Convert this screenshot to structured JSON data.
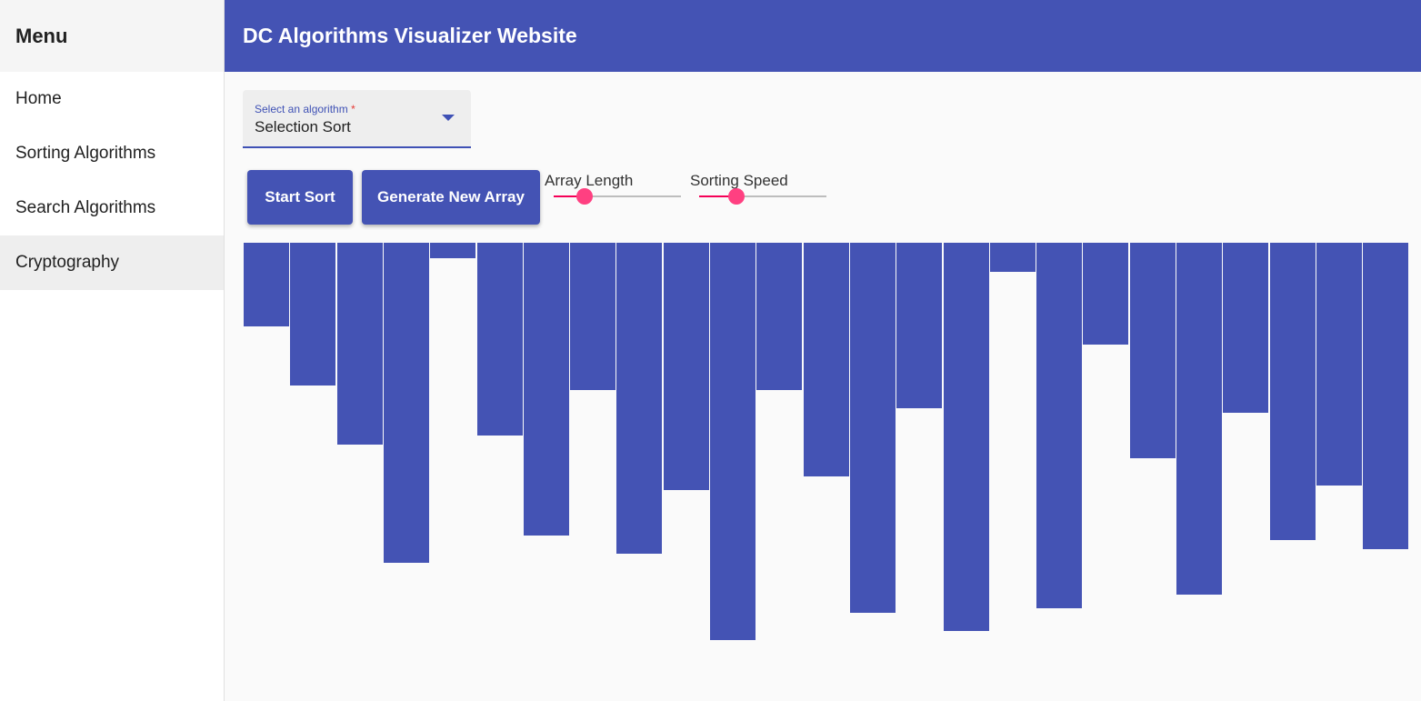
{
  "sidebar": {
    "title": "Menu",
    "items": [
      {
        "label": "Home",
        "active": false
      },
      {
        "label": "Sorting Algorithms",
        "active": false
      },
      {
        "label": "Search Algorithms",
        "active": false
      },
      {
        "label": "Cryptography",
        "active": true
      }
    ]
  },
  "header": {
    "title": "DC Algorithms Visualizer Website"
  },
  "algorithm_select": {
    "label": "Select an algorithm",
    "required_marker": "*",
    "value": "Selection Sort"
  },
  "buttons": {
    "start": "Start Sort",
    "generate": "Generate New Array"
  },
  "sliders": {
    "array_length": {
      "label": "Array Length",
      "value_fraction": 0.24
    },
    "sorting_speed": {
      "label": "Sorting Speed",
      "value_fraction": 0.29
    }
  },
  "colors": {
    "primary": "#4453b4",
    "accent": "#ff4081",
    "background": "#fafafa"
  },
  "array_values": [
    92,
    157,
    222,
    352,
    17,
    212,
    322,
    162,
    342,
    272,
    437,
    162,
    257,
    407,
    182,
    427,
    32,
    402,
    112,
    237,
    387,
    187,
    327,
    267,
    337
  ]
}
